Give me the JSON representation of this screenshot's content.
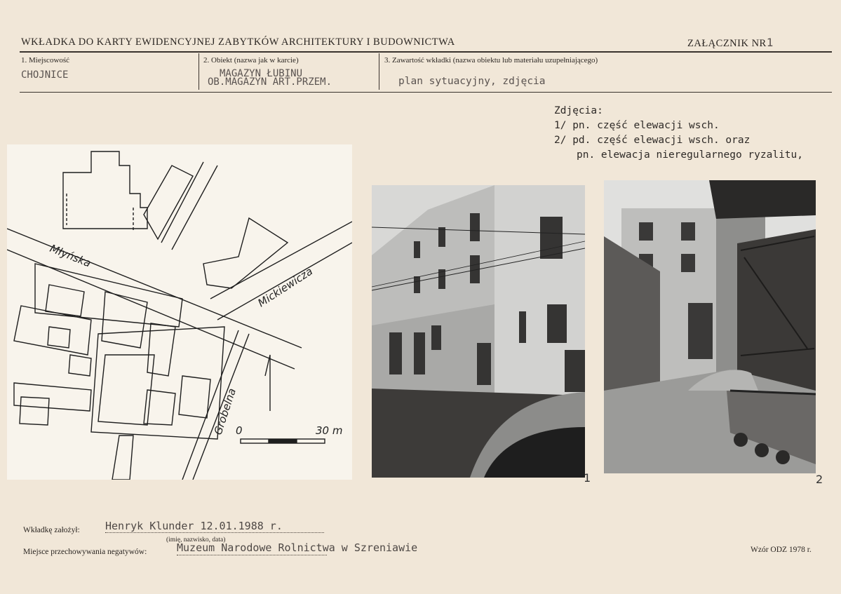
{
  "header": {
    "title": "WKŁADKA DO KARTY EWIDENCYJNEJ ZABYTKÓW ARCHITEKTURY I BUDOWNICTWA",
    "attachment_label": "ZAŁĄCZNIK NR",
    "attachment_no": "1"
  },
  "fields": {
    "locality_label": "1. Miejscowość",
    "locality_value": "CHOJNICE",
    "object_label": "2. Obiekt (nazwa jak w karcie)",
    "object_line1": "MAGAZYN ŁUBINU",
    "object_line2": "OB.MAGAZYN ART.PRZEM.",
    "content_label": "3. Zawartość wkładki (nazwa obiektu lub materiału uzupełniającego)",
    "content_value": "plan sytuacyjny, zdjęcia"
  },
  "photo_notes": {
    "heading": "Zdjęcia:",
    "line1": "1/ pn. część elewacji wsch.",
    "line2": "2/ pd. część elewacji wsch. oraz",
    "line3": "pn. elewacja nieregularnego ryzalitu,"
  },
  "map": {
    "street1": "Młyńska",
    "street2": "Mickiewicza",
    "street3": "Grobelna",
    "scale_start": "0",
    "scale_end": "30 m"
  },
  "photos": {
    "photo1_number": "1",
    "photo2_number": "2"
  },
  "footer": {
    "author_label": "Wkładkę założył:",
    "author_value": "Henryk Klunder 12.01.1988 r.",
    "author_hint": "(imię, nazwisko, data)",
    "storage_label": "Miejsce przechowywania negatywów:",
    "storage_value": "Muzeum Narodowe Rolnictwa w Szreniawie",
    "form_label": "Wzór ODZ 1978 r."
  }
}
